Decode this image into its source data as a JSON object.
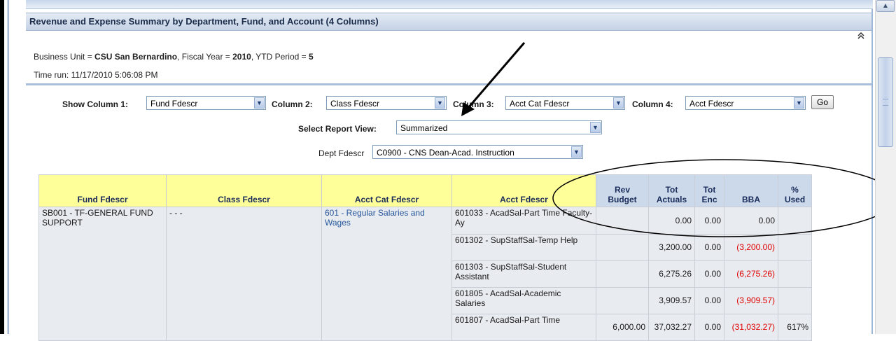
{
  "panel": {
    "title": "Revenue and Expense Summary by Department, Fund, and Account (4 Columns)",
    "collapse_glyph": "«"
  },
  "info": {
    "bu_label": "Business Unit = ",
    "bu_value": "CSU San Bernardino",
    "fy_label": ", Fiscal Year = ",
    "fy_value": "2010",
    "ytd_label": ", YTD Period = ",
    "ytd_value": "5",
    "time_run": "Time run: 11/17/2010 5:06:08 PM"
  },
  "controls": {
    "col1_label": "Show Column 1:",
    "col1_value": "Fund Fdescr",
    "col2_label": "Column 2:",
    "col2_value": "Class Fdescr",
    "col3_label": "Column 3:",
    "col3_value": "Acct Cat Fdescr",
    "col4_label": "Column 4:",
    "col4_value": "Acct Fdescr",
    "go_label": "Go",
    "view_label": "Select Report View:",
    "view_value": "Summarized",
    "dept_label": "Dept Fdescr",
    "dept_value": "C0900 - CNS Dean-Acad. Instruction"
  },
  "table": {
    "headers": {
      "fund": "Fund Fdescr",
      "class": "Class Fdescr",
      "acct_cat": "Acct Cat Fdescr",
      "acct": "Acct Fdescr",
      "rev_budget": "Rev Budget",
      "tot_actuals_1": "Tot",
      "tot_actuals_2": "Actuals",
      "tot_enc_1": "Tot",
      "tot_enc_2": "Enc",
      "bba": "BBA",
      "pct_1": "%",
      "pct_2": "Used"
    },
    "fund_cell": "SB001 - TF-GENERAL FUND SUPPORT",
    "class_cell": "- - -",
    "acct_cat_cell": "601 - Regular Salaries and Wages",
    "rows": [
      {
        "acct": "601033 - AcadSal-Part Time Faculty-Ay",
        "rev_budget": "",
        "tot_actuals": "0.00",
        "tot_enc": "0.00",
        "bba": "0.00",
        "pct": ""
      },
      {
        "acct": "601302 - SupStaffSal-Temp Help",
        "rev_budget": "",
        "tot_actuals": "3,200.00",
        "tot_enc": "0.00",
        "bba": "(3,200.00)",
        "pct": ""
      },
      {
        "acct": "601303 - SupStaffSal-Student Assistant",
        "rev_budget": "",
        "tot_actuals": "6,275.26",
        "tot_enc": "0.00",
        "bba": "(6,275.26)",
        "pct": ""
      },
      {
        "acct": "601805 - AcadSal-Academic Salaries",
        "rev_budget": "",
        "tot_actuals": "3,909.57",
        "tot_enc": "0.00",
        "bba": "(3,909.57)",
        "pct": ""
      },
      {
        "acct": "601807 - AcadSal-Part Time",
        "rev_budget": "6,000.00",
        "tot_actuals": "37,032.27",
        "tot_enc": "0.00",
        "bba": "(31,032.27)",
        "pct": "617%"
      }
    ]
  },
  "scrollbar": {
    "up_glyph": "^"
  },
  "colors": {
    "title_text": "#1a2c4a",
    "yellow_header": "#ffff99",
    "blue_header": "#ccd9ea",
    "negative": "#e00000",
    "link": "#27569a"
  }
}
